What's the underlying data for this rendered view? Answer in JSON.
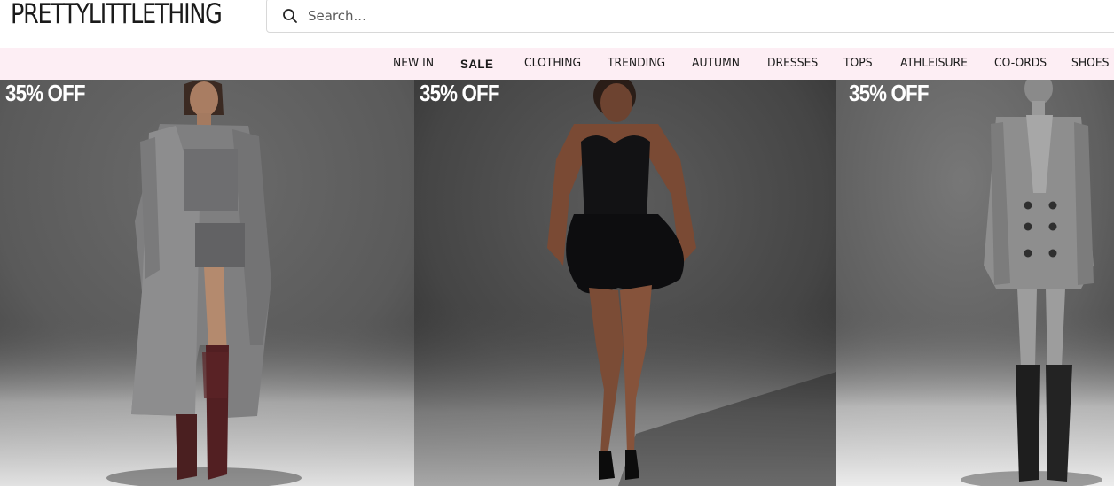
{
  "brand": {
    "logo_text": "PRETTYLITTLETHING"
  },
  "search": {
    "placeholder": "Search...",
    "icon": "search-icon"
  },
  "nav": {
    "items": [
      {
        "label": "NEW IN"
      },
      {
        "label": "SALE",
        "emphasis": "bold"
      },
      {
        "label": "CLOTHING"
      },
      {
        "label": "TRENDING"
      },
      {
        "label": "AUTUMN"
      },
      {
        "label": "DRESSES"
      },
      {
        "label": "TOPS"
      },
      {
        "label": "ATHLEISURE"
      },
      {
        "label": "CO-ORDS"
      },
      {
        "label": "SHOES"
      }
    ]
  },
  "promos": [
    {
      "badge": "35% OFF"
    },
    {
      "badge": "35% OFF"
    },
    {
      "badge": "35% OFF"
    }
  ],
  "colors": {
    "nav_background": "#fdeef4",
    "text": "#1a1a1a",
    "badge_text": "#ffffff"
  }
}
